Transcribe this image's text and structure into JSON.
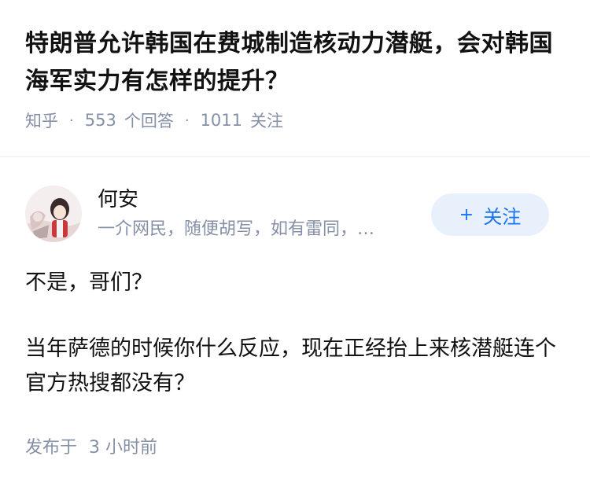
{
  "question": {
    "title": "特朗普允许韩国在费城制造核动力潜艇，会对韩国海军实力有怎样的提升？",
    "source": "知乎",
    "answer_count": "553",
    "answer_label": "个回答",
    "follower_count": "1011",
    "follower_label": "关注"
  },
  "author": {
    "name": "何安",
    "bio": "一介网民，随便胡写，如有雷同，…",
    "follow_label": "关注",
    "follow_icon": "plus-icon"
  },
  "answer": {
    "paragraphs": [
      "不是，哥们？",
      "当年萨德的时候你什么反应，现在正经抬上来核潜艇连个官方热搜都没有？"
    ],
    "published_label": "发布于",
    "published_time": "3 小时前"
  },
  "colors": {
    "accent": "#1772f6",
    "follow_bg": "#e8f1fb",
    "meta_gray": "#8590a6"
  }
}
